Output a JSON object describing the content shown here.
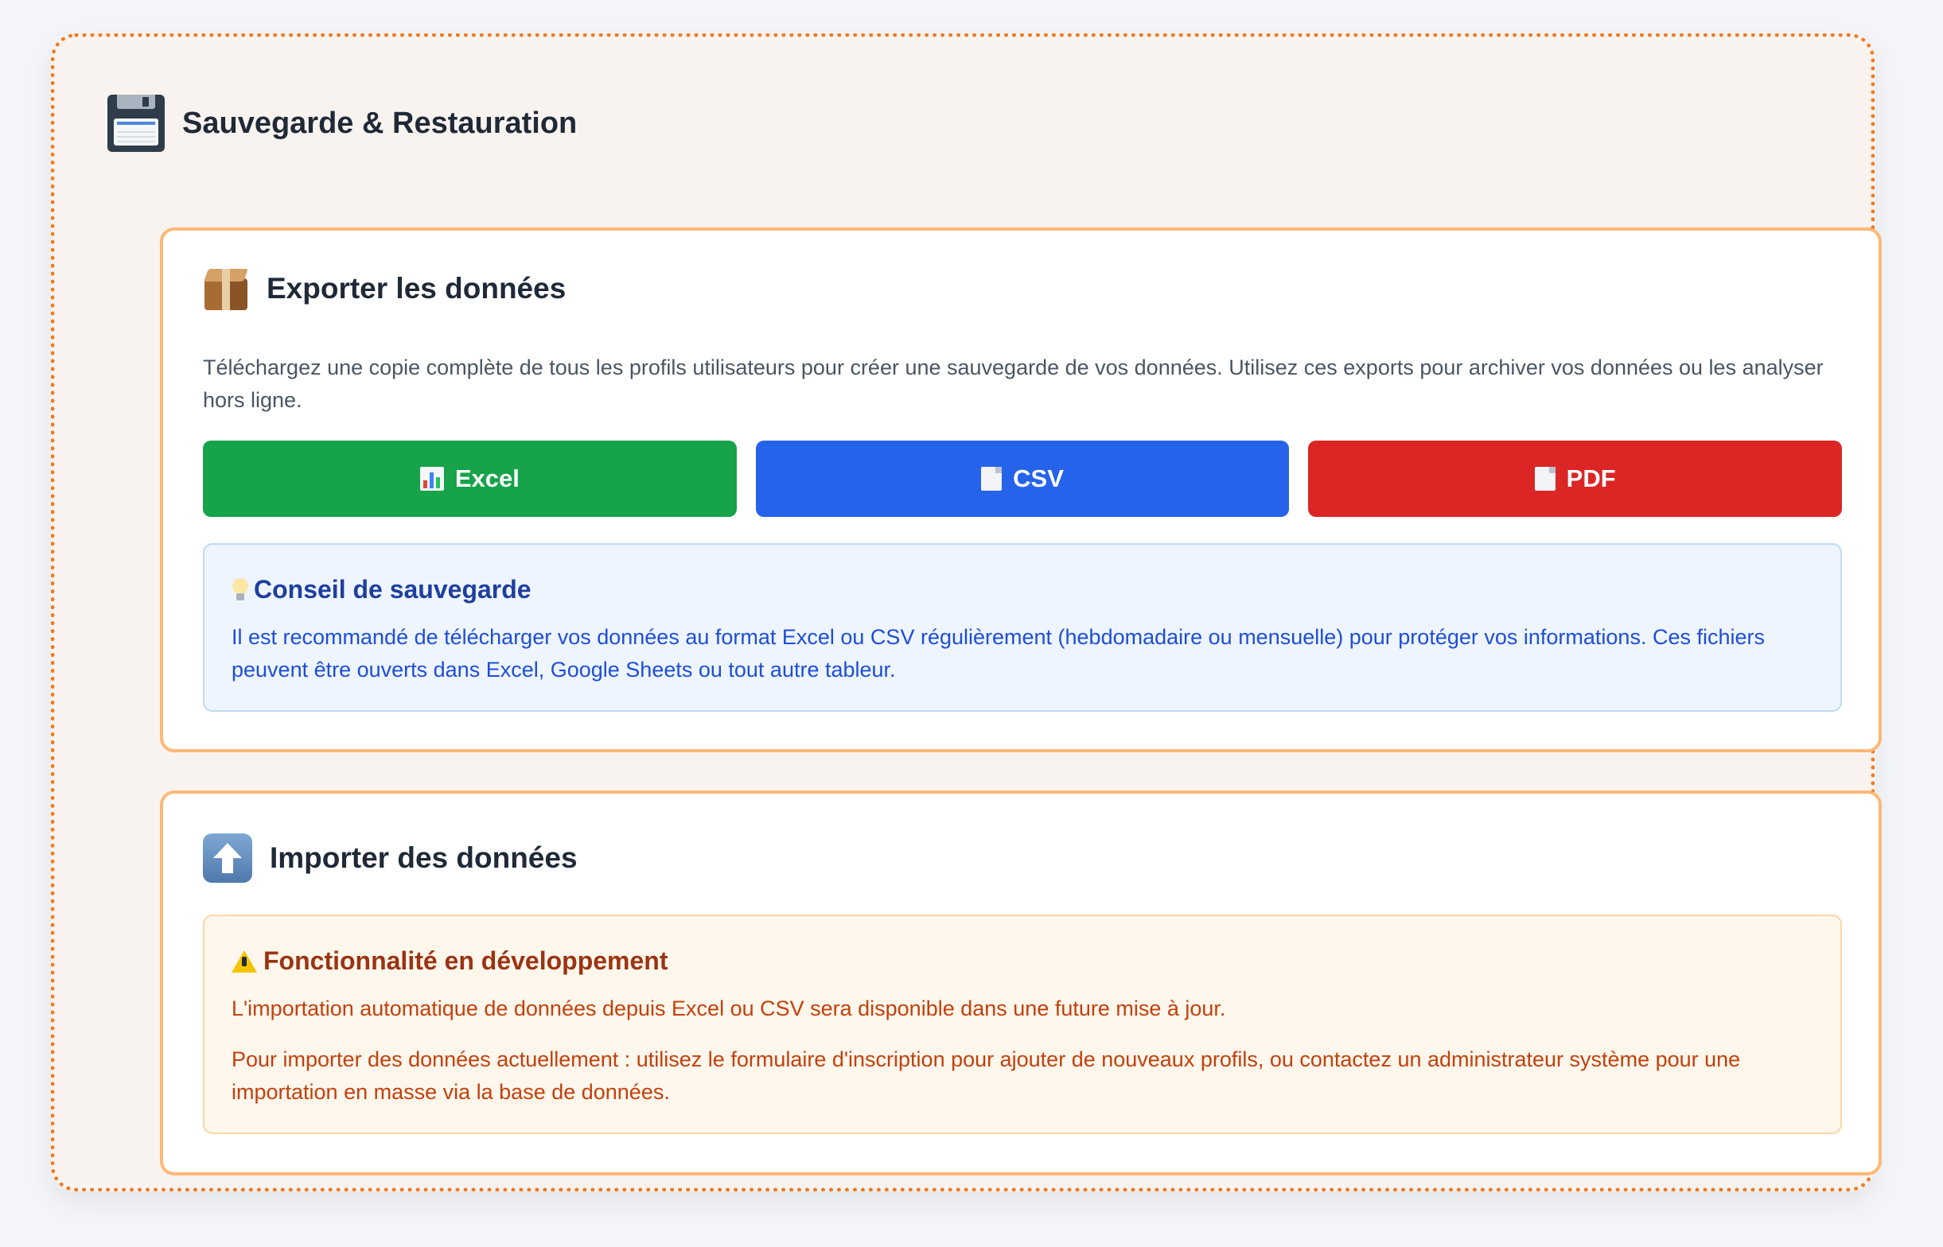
{
  "header": {
    "title": "Sauvegarde & Restauration",
    "icon": "floppy-disk-icon"
  },
  "export": {
    "title": "Exporter les données",
    "icon": "package-icon",
    "description": "Téléchargez une copie complète de tous les profils utilisateurs pour créer une sauvegarde de vos données. Utilisez ces exports pour archiver vos données ou les analyser hors ligne.",
    "buttons": [
      {
        "label": "Excel",
        "icon": "bar-chart-icon",
        "color": "#16a34a"
      },
      {
        "label": "CSV",
        "icon": "document-icon",
        "color": "#2563eb"
      },
      {
        "label": "PDF",
        "icon": "document-icon",
        "color": "#dc2626"
      }
    ],
    "tip": {
      "title": "Conseil de sauvegarde",
      "icon": "lightbulb-icon",
      "text": "Il est recommandé de télécharger vos données au format Excel ou CSV régulièrement (hebdomadaire ou mensuelle) pour protéger vos informations. Ces fichiers peuvent être ouverts dans Excel, Google Sheets ou tout autre tableur."
    }
  },
  "import": {
    "title": "Importer des données",
    "icon": "arrow-up-icon",
    "warning": {
      "title": "Fonctionnalité en développement",
      "icon": "warning-icon",
      "text_1": "L'importation automatique de données depuis Excel ou CSV sera disponible dans une future mise à jour.",
      "text_2": "Pour importer des données actuellement : utilisez le formulaire d'inscription pour ajouter de nouveaux profils, ou contactez un administrateur système pour une importation en masse via la base de données."
    }
  },
  "colors": {
    "accent_border": "#f07a22",
    "card_border": "#fdb877",
    "excel": "#16a34a",
    "csv": "#2563eb",
    "pdf": "#dc2626"
  }
}
